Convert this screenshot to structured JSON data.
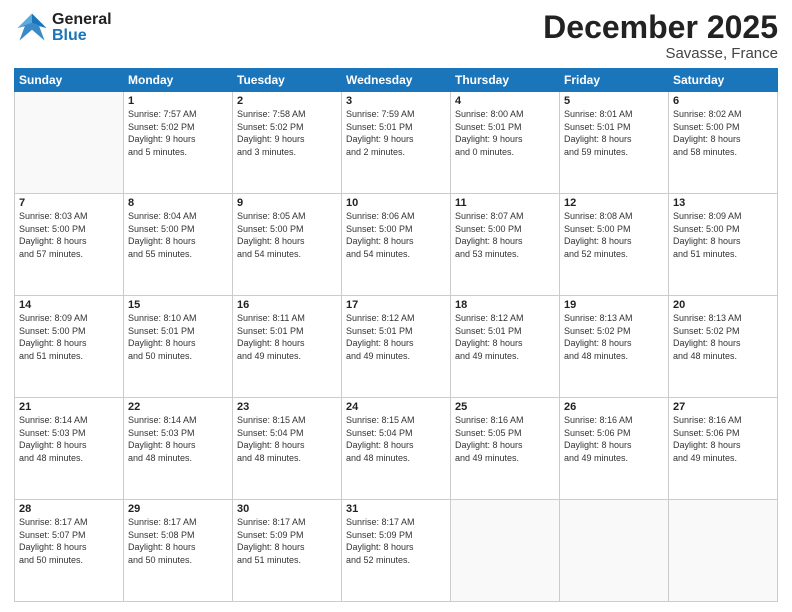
{
  "header": {
    "logo_general": "General",
    "logo_blue": "Blue",
    "month_title": "December 2025",
    "location": "Savasse, France"
  },
  "days_of_week": [
    "Sunday",
    "Monday",
    "Tuesday",
    "Wednesday",
    "Thursday",
    "Friday",
    "Saturday"
  ],
  "weeks": [
    [
      {
        "day": "",
        "info": ""
      },
      {
        "day": "1",
        "info": "Sunrise: 7:57 AM\nSunset: 5:02 PM\nDaylight: 9 hours\nand 5 minutes."
      },
      {
        "day": "2",
        "info": "Sunrise: 7:58 AM\nSunset: 5:02 PM\nDaylight: 9 hours\nand 3 minutes."
      },
      {
        "day": "3",
        "info": "Sunrise: 7:59 AM\nSunset: 5:01 PM\nDaylight: 9 hours\nand 2 minutes."
      },
      {
        "day": "4",
        "info": "Sunrise: 8:00 AM\nSunset: 5:01 PM\nDaylight: 9 hours\nand 0 minutes."
      },
      {
        "day": "5",
        "info": "Sunrise: 8:01 AM\nSunset: 5:01 PM\nDaylight: 8 hours\nand 59 minutes."
      },
      {
        "day": "6",
        "info": "Sunrise: 8:02 AM\nSunset: 5:00 PM\nDaylight: 8 hours\nand 58 minutes."
      }
    ],
    [
      {
        "day": "7",
        "info": "Sunrise: 8:03 AM\nSunset: 5:00 PM\nDaylight: 8 hours\nand 57 minutes."
      },
      {
        "day": "8",
        "info": "Sunrise: 8:04 AM\nSunset: 5:00 PM\nDaylight: 8 hours\nand 55 minutes."
      },
      {
        "day": "9",
        "info": "Sunrise: 8:05 AM\nSunset: 5:00 PM\nDaylight: 8 hours\nand 54 minutes."
      },
      {
        "day": "10",
        "info": "Sunrise: 8:06 AM\nSunset: 5:00 PM\nDaylight: 8 hours\nand 54 minutes."
      },
      {
        "day": "11",
        "info": "Sunrise: 8:07 AM\nSunset: 5:00 PM\nDaylight: 8 hours\nand 53 minutes."
      },
      {
        "day": "12",
        "info": "Sunrise: 8:08 AM\nSunset: 5:00 PM\nDaylight: 8 hours\nand 52 minutes."
      },
      {
        "day": "13",
        "info": "Sunrise: 8:09 AM\nSunset: 5:00 PM\nDaylight: 8 hours\nand 51 minutes."
      }
    ],
    [
      {
        "day": "14",
        "info": "Sunrise: 8:09 AM\nSunset: 5:00 PM\nDaylight: 8 hours\nand 51 minutes."
      },
      {
        "day": "15",
        "info": "Sunrise: 8:10 AM\nSunset: 5:01 PM\nDaylight: 8 hours\nand 50 minutes."
      },
      {
        "day": "16",
        "info": "Sunrise: 8:11 AM\nSunset: 5:01 PM\nDaylight: 8 hours\nand 49 minutes."
      },
      {
        "day": "17",
        "info": "Sunrise: 8:12 AM\nSunset: 5:01 PM\nDaylight: 8 hours\nand 49 minutes."
      },
      {
        "day": "18",
        "info": "Sunrise: 8:12 AM\nSunset: 5:01 PM\nDaylight: 8 hours\nand 49 minutes."
      },
      {
        "day": "19",
        "info": "Sunrise: 8:13 AM\nSunset: 5:02 PM\nDaylight: 8 hours\nand 48 minutes."
      },
      {
        "day": "20",
        "info": "Sunrise: 8:13 AM\nSunset: 5:02 PM\nDaylight: 8 hours\nand 48 minutes."
      }
    ],
    [
      {
        "day": "21",
        "info": "Sunrise: 8:14 AM\nSunset: 5:03 PM\nDaylight: 8 hours\nand 48 minutes."
      },
      {
        "day": "22",
        "info": "Sunrise: 8:14 AM\nSunset: 5:03 PM\nDaylight: 8 hours\nand 48 minutes."
      },
      {
        "day": "23",
        "info": "Sunrise: 8:15 AM\nSunset: 5:04 PM\nDaylight: 8 hours\nand 48 minutes."
      },
      {
        "day": "24",
        "info": "Sunrise: 8:15 AM\nSunset: 5:04 PM\nDaylight: 8 hours\nand 48 minutes."
      },
      {
        "day": "25",
        "info": "Sunrise: 8:16 AM\nSunset: 5:05 PM\nDaylight: 8 hours\nand 49 minutes."
      },
      {
        "day": "26",
        "info": "Sunrise: 8:16 AM\nSunset: 5:06 PM\nDaylight: 8 hours\nand 49 minutes."
      },
      {
        "day": "27",
        "info": "Sunrise: 8:16 AM\nSunset: 5:06 PM\nDaylight: 8 hours\nand 49 minutes."
      }
    ],
    [
      {
        "day": "28",
        "info": "Sunrise: 8:17 AM\nSunset: 5:07 PM\nDaylight: 8 hours\nand 50 minutes."
      },
      {
        "day": "29",
        "info": "Sunrise: 8:17 AM\nSunset: 5:08 PM\nDaylight: 8 hours\nand 50 minutes."
      },
      {
        "day": "30",
        "info": "Sunrise: 8:17 AM\nSunset: 5:09 PM\nDaylight: 8 hours\nand 51 minutes."
      },
      {
        "day": "31",
        "info": "Sunrise: 8:17 AM\nSunset: 5:09 PM\nDaylight: 8 hours\nand 52 minutes."
      },
      {
        "day": "",
        "info": ""
      },
      {
        "day": "",
        "info": ""
      },
      {
        "day": "",
        "info": ""
      }
    ]
  ]
}
